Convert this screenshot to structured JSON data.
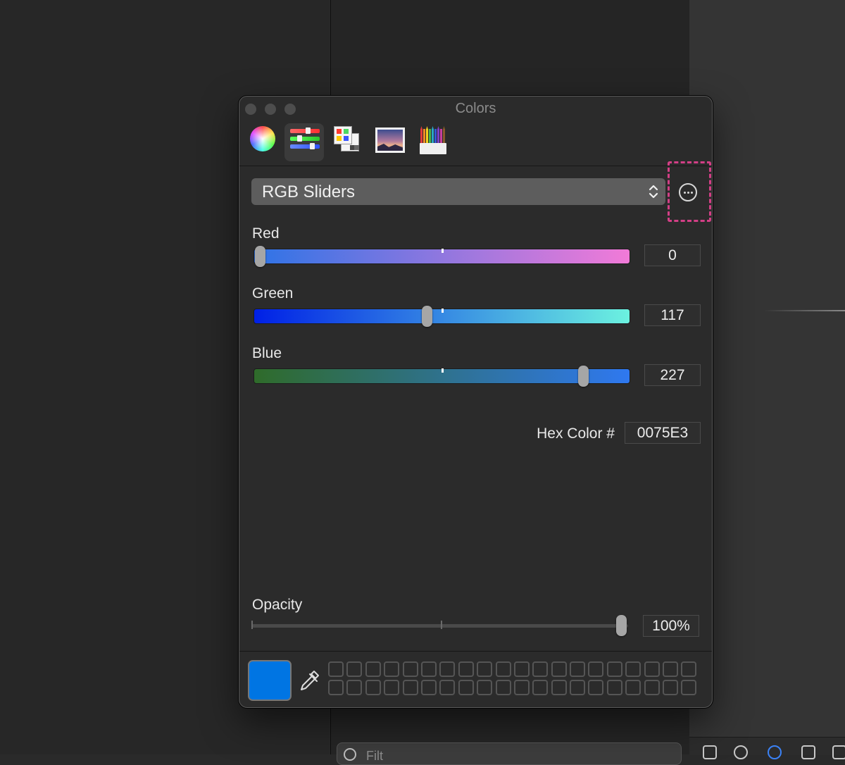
{
  "window": {
    "title": "Colors"
  },
  "mode_tabs": [
    {
      "name": "Color Wheel",
      "icon": "color-wheel-icon",
      "selected": false
    },
    {
      "name": "Color Sliders",
      "icon": "color-sliders-icon",
      "selected": true
    },
    {
      "name": "Color Palettes",
      "icon": "color-palettes-icon",
      "selected": false
    },
    {
      "name": "Image Palettes",
      "icon": "image-palettes-icon",
      "selected": false
    },
    {
      "name": "Pencils",
      "icon": "pencils-icon",
      "selected": false
    }
  ],
  "slider_type": {
    "selected": "RGB Sliders"
  },
  "more_button": {
    "icon": "ellipsis-circle-icon"
  },
  "sliders": {
    "red": {
      "label": "Red",
      "value": "0",
      "fraction": 0.0
    },
    "green": {
      "label": "Green",
      "value": "117",
      "fraction": 0.459
    },
    "blue": {
      "label": "Blue",
      "value": "227",
      "fraction": 0.89
    }
  },
  "hex": {
    "label": "Hex Color #",
    "value": "0075E3"
  },
  "opacity": {
    "label": "Opacity",
    "value": "100%",
    "fraction": 1.0
  },
  "current_color": "#0075E3",
  "background": {
    "filter_placeholder": "Filt"
  }
}
